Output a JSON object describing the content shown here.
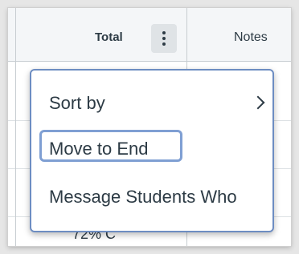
{
  "gradebook": {
    "columns": [
      {
        "label": "Total"
      },
      {
        "label": "Notes"
      }
    ],
    "partial_cell_text": "72%   C"
  },
  "column_menu": {
    "items": [
      {
        "label": "Sort by",
        "has_submenu": true
      },
      {
        "label": "Move to End",
        "focused": true
      },
      {
        "label": "Message Students Who"
      }
    ]
  },
  "icons": {
    "kebab": "vertical-ellipsis-icon",
    "submenu": "chevron-right-icon"
  },
  "colors": {
    "menu_border": "#6d8dc2",
    "focus_ring": "#7f9fd3",
    "text": "#2d3b45"
  }
}
